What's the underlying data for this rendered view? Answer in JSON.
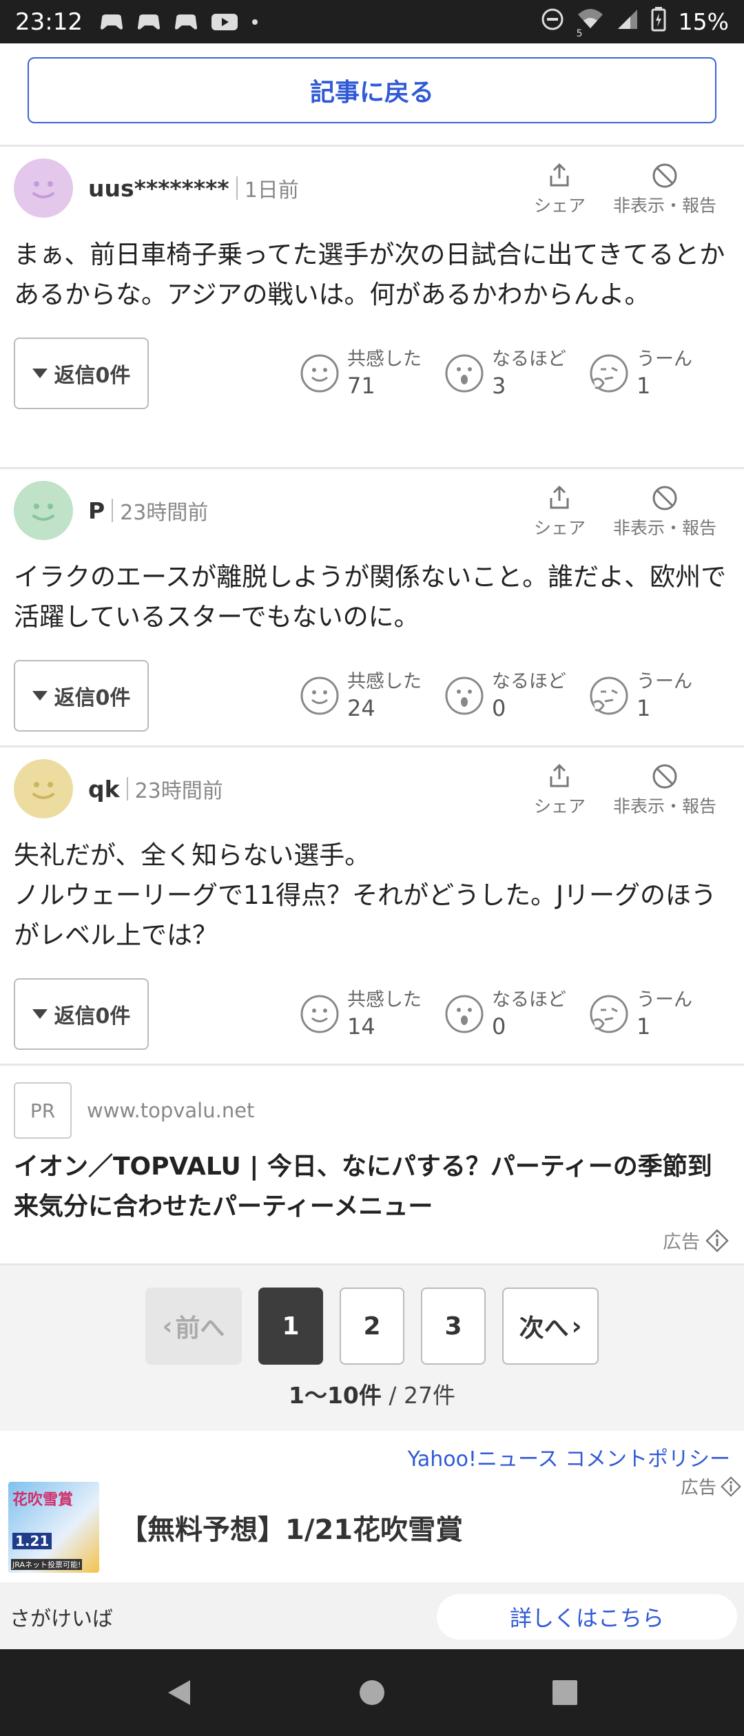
{
  "status_bar": {
    "time": "23:12",
    "battery": "15%",
    "network": "5"
  },
  "back_button": {
    "label": "記事に戻る"
  },
  "comment_actions": {
    "share": "シェア",
    "hide_report": "非表示・報告"
  },
  "reaction_labels": {
    "empathy": "共感した",
    "naruhodo": "なるほど",
    "uun": "うーん"
  },
  "reply_label": "返信0件",
  "comments": [
    {
      "user": "uus********",
      "time": "1日前",
      "avatar_color": "#e3c8ec",
      "face_color": "#c79ad8",
      "text": "まぁ、前日車椅子乗ってた選手が次の日試合に出てきてるとかあるからな。アジアの戦いは。何があるかわからんよ。",
      "reactions": {
        "empathy": "71",
        "naruhodo": "3",
        "uun": "1"
      }
    },
    {
      "user": "P",
      "time": "23時間前",
      "avatar_color": "#bfe2c8",
      "face_color": "#86c59a",
      "text": "イラクのエースが離脱しようが関係ないこと。誰だよ、欧州で活躍しているスターでもないのに。",
      "reactions": {
        "empathy": "24",
        "naruhodo": "0",
        "uun": "1"
      }
    },
    {
      "user": "qk",
      "time": "23時間前",
      "avatar_color": "#ecdca0",
      "face_color": "#cdb55e",
      "text_lines": [
        "失礼だが、全く知らない選手。",
        "ノルウェーリーグで11得点？それがどうした。Jリーグのほうがレベル上では？"
      ],
      "reactions": {
        "empathy": "14",
        "naruhodo": "0",
        "uun": "1"
      }
    }
  ],
  "ad": {
    "pr": "PR",
    "url": "www.topvalu.net",
    "title": "イオン／TOPVALU | 今日、なにパする？パーティーの季節到来気分に合わせたパーティーメニュー",
    "label": "広告"
  },
  "pagination": {
    "prev": "前へ",
    "next": "次へ",
    "pages": [
      "1",
      "2",
      "3"
    ],
    "active": "1",
    "range": "1〜10件",
    "total": "/ 27件"
  },
  "policy_link": "Yahoo!ニュース コメントポリシー",
  "banner_ad": {
    "label": "広告",
    "title": "【無料予想】1/21花吹雪賞",
    "thumb_text": "花吹雪賞",
    "thumb_date": "1.21",
    "thumb_note": "JRAネット投票可能!",
    "advertiser": "さがけいば",
    "cta": "詳しくはこちら"
  }
}
